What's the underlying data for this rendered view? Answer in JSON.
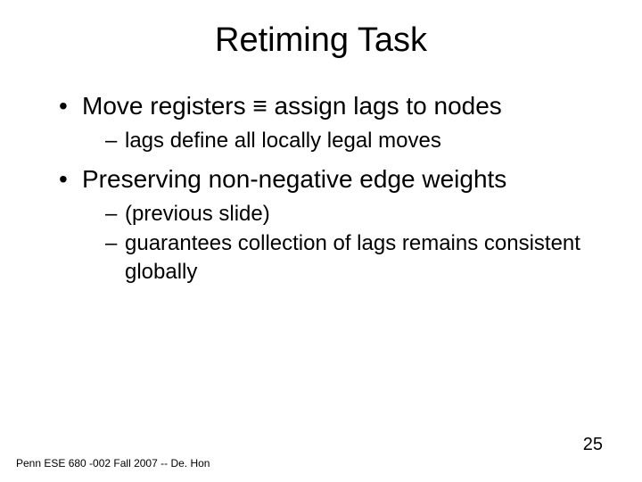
{
  "title": "Retiming Task",
  "bullets": [
    {
      "text": "Move registers ≡ assign lags to nodes",
      "sub": [
        "lags define all locally legal moves"
      ]
    },
    {
      "text": "Preserving non-negative edge weights",
      "sub": [
        "(previous slide)",
        "guarantees collection of lags remains consistent globally"
      ]
    }
  ],
  "footer": "Penn ESE 680 -002 Fall 2007 -- De. Hon",
  "page_number": "25"
}
